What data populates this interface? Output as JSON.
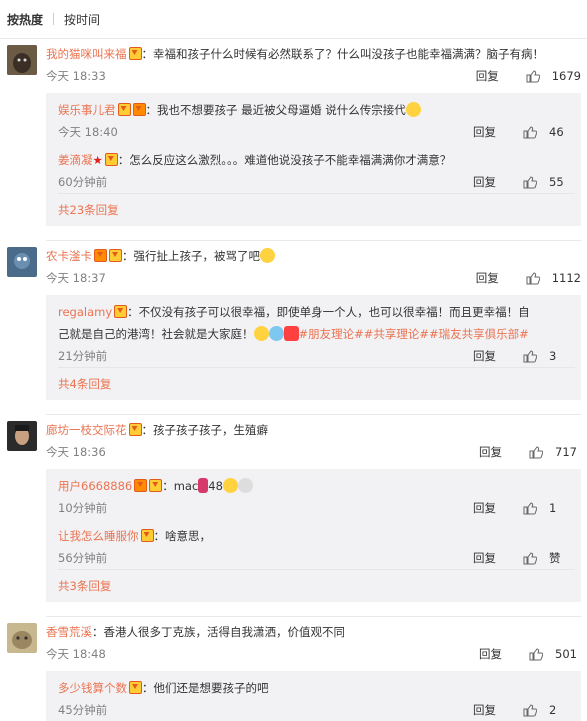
{
  "sort": {
    "hot": "按热度",
    "time": "按时间"
  },
  "actions": {
    "reply": "回复"
  },
  "comments": [
    {
      "user": "我的猫咪叫来福",
      "text": "：幸福和孩子什么时候有必然联系了？什么叫没孩子也能幸福满满？脑子有病！",
      "time": "今天 18:33",
      "likes": "1679",
      "replies": [
        {
          "user": "娱乐事儿君",
          "text": "：我也不想要孩子 最近被父母逼婚 说什么传宗接代",
          "time": "今天 18:40",
          "likes": "46"
        },
        {
          "user": "姜滴凝",
          "text": "：怎么反应这么激烈。。。难道他说没孩子不能幸福满满你才满意？",
          "time": "60分钟前",
          "likes": "55"
        }
      ],
      "more": "共23条回复"
    },
    {
      "user": "农卡滏卡",
      "text": "：强行扯上孩子，被骂了吧",
      "time": "今天 18:37",
      "likes": "1112",
      "replies": [
        {
          "user": "regalamy",
          "text": "：不仅没有孩子可以很幸福，即使单身一个人，也可以很幸福！而且更幸福！自",
          "text2": "己就是自己的港湾！社会就是大家庭！",
          "tags": "#朋友理论##共享理论##瑞友共享俱乐部#",
          "time": "21分钟前",
          "likes": "3"
        }
      ],
      "more": "共4条回复"
    },
    {
      "user": "廊坊一枝交际花",
      "text": "：孩子孩子孩子，生殖癖",
      "time": "今天 18:36",
      "likes": "717",
      "replies": [
        {
          "user": "用户6668886",
          "text": "：mac",
          "after": "48",
          "time": "10分钟前",
          "likes": "1"
        },
        {
          "user": "让我怎么睡服你",
          "text": "：啥意思，",
          "time": "56分钟前",
          "likes": "赞"
        }
      ],
      "more": "共3条回复"
    },
    {
      "user": "香雪荒溪",
      "text": "：香港人很多丁克族，活得自我潇洒，价值观不同",
      "time": "今天 18:48",
      "likes": "501",
      "replies": [
        {
          "user": "多少钱算个数",
          "text": "：他们还是想要孩子的吧",
          "time": "45分钟前",
          "likes": "2"
        }
      ]
    }
  ],
  "colors": {
    "accent": "#eb7350",
    "reply_bg": "#f2f2f5"
  }
}
